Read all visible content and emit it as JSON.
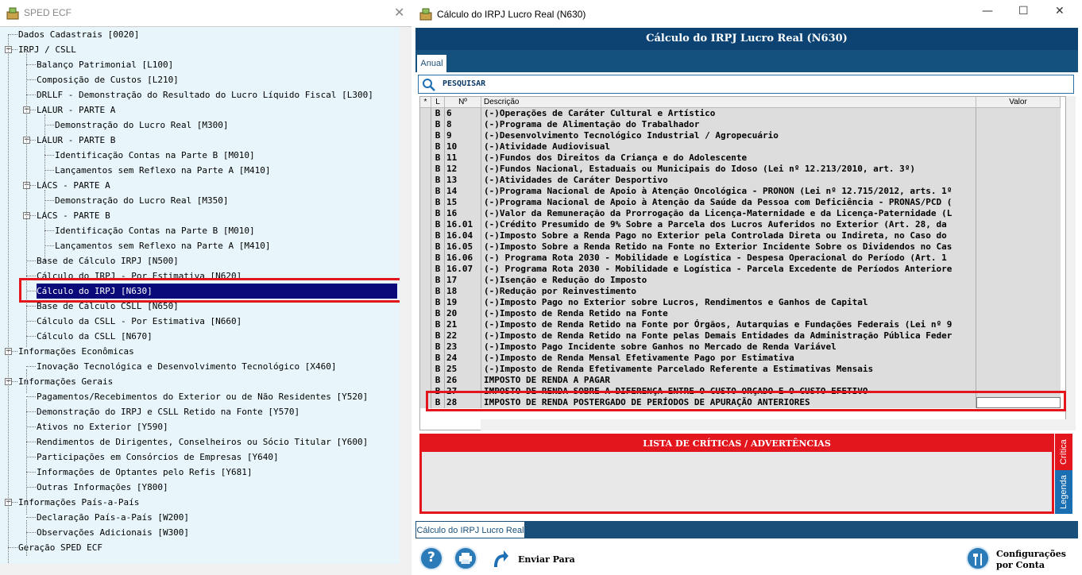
{
  "left_window": {
    "title": "SPED ECF",
    "tree": [
      {
        "label": "Dados Cadastrais [0020]",
        "level": 0,
        "expander": ""
      },
      {
        "label": "IRPJ / CSLL",
        "level": 0,
        "expander": "−"
      },
      {
        "label": "Balanço Patrimonial [L100]",
        "level": 1,
        "expander": ""
      },
      {
        "label": "Composição de Custos [L210]",
        "level": 1,
        "expander": ""
      },
      {
        "label": "DRLLF - Demonstração do Resultado do Lucro Líquido Fiscal [L300]",
        "level": 1,
        "expander": ""
      },
      {
        "label": "LALUR - PARTE A",
        "level": 1,
        "expander": "−"
      },
      {
        "label": "Demonstração do Lucro Real [M300]",
        "level": 2,
        "expander": ""
      },
      {
        "label": "LALUR - PARTE B",
        "level": 1,
        "expander": "−"
      },
      {
        "label": "Identificação Contas na Parte B [M010]",
        "level": 2,
        "expander": ""
      },
      {
        "label": "Lançamentos sem Reflexo na Parte A [M410]",
        "level": 2,
        "expander": ""
      },
      {
        "label": "LACS - PARTE A",
        "level": 1,
        "expander": "−"
      },
      {
        "label": "Demonstração do Lucro Real [M350]",
        "level": 2,
        "expander": ""
      },
      {
        "label": "LACS - PARTE B",
        "level": 1,
        "expander": "−"
      },
      {
        "label": "Identificação Contas na Parte B [M010]",
        "level": 2,
        "expander": ""
      },
      {
        "label": "Lançamentos sem Reflexo na Parte A [M410]",
        "level": 2,
        "expander": ""
      },
      {
        "label": "Base de Cálculo IRPJ [N500]",
        "level": 1,
        "expander": ""
      },
      {
        "label": "Cálculo do IRPJ - Por Estimativa [N620]",
        "level": 1,
        "expander": ""
      },
      {
        "label": "Cálculo do IRPJ [N630]",
        "level": 1,
        "expander": "",
        "selected": true
      },
      {
        "label": "Base de Cálculo CSLL [N650]",
        "level": 1,
        "expander": ""
      },
      {
        "label": "Cálculo da CSLL - Por Estimativa [N660]",
        "level": 1,
        "expander": ""
      },
      {
        "label": "Cálculo da CSLL [N670]",
        "level": 1,
        "expander": ""
      },
      {
        "label": "Informações Econômicas",
        "level": 0,
        "expander": "−"
      },
      {
        "label": "Inovação Tecnológica e Desenvolvimento Tecnológico [X460]",
        "level": 1,
        "expander": ""
      },
      {
        "label": "Informações Gerais",
        "level": 0,
        "expander": "−"
      },
      {
        "label": "Pagamentos/Recebimentos do Exterior ou de Não Residentes [Y520]",
        "level": 1,
        "expander": ""
      },
      {
        "label": "Demonstração do IRPJ e CSLL Retido na Fonte [Y570]",
        "level": 1,
        "expander": ""
      },
      {
        "label": "Ativos no Exterior [Y590]",
        "level": 1,
        "expander": ""
      },
      {
        "label": "Rendimentos de Dirigentes, Conselheiros ou Sócio Titular [Y600]",
        "level": 1,
        "expander": ""
      },
      {
        "label": "Participações em Consórcios de Empresas [Y640]",
        "level": 1,
        "expander": ""
      },
      {
        "label": "Informações de Optantes pelo Refis [Y681]",
        "level": 1,
        "expander": ""
      },
      {
        "label": "Outras Informações [Y800]",
        "level": 1,
        "expander": ""
      },
      {
        "label": "Informações País-a-País",
        "level": 0,
        "expander": "−"
      },
      {
        "label": "Declaração País-a-País [W200]",
        "level": 1,
        "expander": ""
      },
      {
        "label": "Observações Adicionais [W300]",
        "level": 1,
        "expander": ""
      },
      {
        "label": "Geração SPED ECF",
        "level": 0,
        "expander": ""
      }
    ]
  },
  "right_window": {
    "title": "Cálculo do IRPJ Lucro Real (N630)",
    "header": "Cálculo do IRPJ Lucro Real (N630)",
    "tab": "Anual",
    "search_label": "PESQUISAR",
    "columns": [
      "*",
      "L",
      "Nº",
      "Descrição",
      "Valor"
    ],
    "rows": [
      {
        "l": "B",
        "n": "6",
        "d": "(-)Operações de Caráter Cultural e Artístico"
      },
      {
        "l": "B",
        "n": "8",
        "d": "(-)Programa de Alimentação do Trabalhador"
      },
      {
        "l": "B",
        "n": "9",
        "d": "(-)Desenvolvimento Tecnológico Industrial / Agropecuário"
      },
      {
        "l": "B",
        "n": "10",
        "d": "(-)Atividade Audiovisual"
      },
      {
        "l": "B",
        "n": "11",
        "d": "(-)Fundos dos Direitos da Criança e do Adolescente"
      },
      {
        "l": "B",
        "n": "12",
        "d": "(-)Fundos Nacional, Estaduais ou Municipais do Idoso (Lei nº 12.213/2010, art. 3º)"
      },
      {
        "l": "B",
        "n": "13",
        "d": "(-)Atividades de Caráter Desportivo"
      },
      {
        "l": "B",
        "n": "14",
        "d": "(-)Programa Nacional de Apoio à Atenção Oncológica - PRONON (Lei nº 12.715/2012, arts. 1º"
      },
      {
        "l": "B",
        "n": "15",
        "d": "(-)Programa Nacional de Apoio à Atenção da Saúde da Pessoa com Deficiência - PRONAS/PCD ("
      },
      {
        "l": "B",
        "n": "16",
        "d": "(-)Valor da Remuneração da Prorrogação da Licença-Maternidade e da Licença-Paternidade (L"
      },
      {
        "l": "B",
        "n": "16.01",
        "d": "(-)Crédito Presumido de 9% Sobre a Parcela dos Lucros Auferidos no Exterior (Art. 28, da"
      },
      {
        "l": "B",
        "n": "16.04",
        "d": "(-)Imposto Sobre a Renda Pago no Exterior pela Controlada Direta ou Indireta, no Caso do"
      },
      {
        "l": "B",
        "n": "16.05",
        "d": "(-)Imposto Sobre a Renda Retido na Fonte no Exterior Incidente Sobre os Dividendos no Cas"
      },
      {
        "l": "B",
        "n": "16.06",
        "d": "(-) Programa Rota 2030 - Mobilidade e Logística - Despesa Operacional do Período (Art. 1"
      },
      {
        "l": "B",
        "n": "16.07",
        "d": "(-) Programa Rota 2030 - Mobilidade e Logística - Parcela Excedente de Períodos Anteriore"
      },
      {
        "l": "B",
        "n": "17",
        "d": "(-)Isenção e Redução do Imposto"
      },
      {
        "l": "B",
        "n": "18",
        "d": "(-)Redução por Reinvestimento"
      },
      {
        "l": "B",
        "n": "19",
        "d": "(-)Imposto Pago no Exterior sobre Lucros, Rendimentos e Ganhos de Capital"
      },
      {
        "l": "B",
        "n": "20",
        "d": "(-)Imposto de Renda Retido na Fonte"
      },
      {
        "l": "B",
        "n": "21",
        "d": "(-)Imposto de Renda Retido na Fonte por Órgãos, Autarquias e Fundações Federais (Lei nº 9"
      },
      {
        "l": "B",
        "n": "22",
        "d": "(-)Imposto de Renda Retido na Fonte pelas Demais Entidades da Administração Pública Feder"
      },
      {
        "l": "B",
        "n": "23",
        "d": "(-)Imposto Pago Incidente sobre Ganhos no Mercado de Renda Variável"
      },
      {
        "l": "B",
        "n": "24",
        "d": "(-)Imposto de Renda Mensal Efetivamente Pago por Estimativa"
      },
      {
        "l": "B",
        "n": "25",
        "d": "(-)Imposto de Renda Efetivamente Parcelado Referente a Estimativas Mensais"
      },
      {
        "l": "B",
        "n": "26",
        "d": "IMPOSTO DE RENDA A PAGAR"
      },
      {
        "l": "B",
        "n": "27",
        "d": "IMPOSTO DE RENDA SOBRE A DIFERENÇA ENTRE O CUSTO ORÇADO E O CUSTO EFETIVO"
      },
      {
        "l": "B",
        "n": "28",
        "d": "IMPOSTO DE RENDA POSTERGADO DE PERÍODOS DE APURAÇÃO ANTERIORES"
      }
    ],
    "critics_header": "LISTA DE CRÍTICAS / ADVERTÊNCIAS",
    "side_tabs": [
      "Crítica",
      "Legenda"
    ],
    "bottom_tab": "Cálculo do IRPJ Lucro Real",
    "buttons": {
      "send": "Enviar Para",
      "config_line1": "Configurações",
      "config_line2": "por Conta"
    }
  },
  "colors": {
    "navy": "#0c4373",
    "accent_red": "#e3151d",
    "tree_bg": "#e8f6fb",
    "selected": "#0a0a7a"
  }
}
